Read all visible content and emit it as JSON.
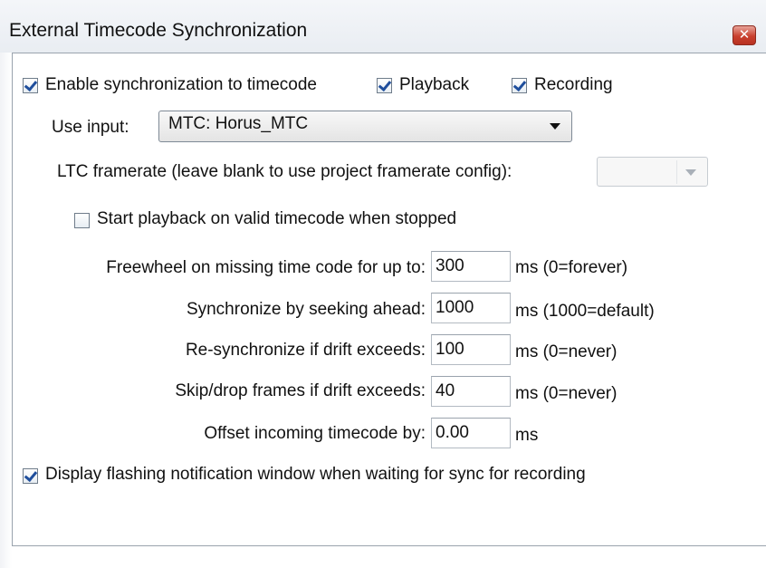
{
  "window": {
    "title": "External Timecode Synchronization",
    "close_glyph": "✕"
  },
  "sync": {
    "enable_label": "Enable synchronization to timecode",
    "enable_checked": true,
    "playback_label": "Playback",
    "playback_checked": true,
    "recording_label": "Recording",
    "recording_checked": true
  },
  "input": {
    "label": "Use input:",
    "value": "MTC: Horus_MTC"
  },
  "ltc": {
    "label": "LTC framerate (leave blank to use project framerate config):",
    "value": ""
  },
  "start_playback": {
    "label": "Start playback on valid timecode when stopped",
    "checked": false
  },
  "settings": {
    "freewheel": {
      "label": "Freewheel on missing time code for up to:",
      "value": "300",
      "unit": "ms (0=forever)"
    },
    "seek_ahead": {
      "label": "Synchronize by seeking ahead:",
      "value": "1000",
      "unit": "ms (1000=default)"
    },
    "resync": {
      "label": "Re-synchronize if drift exceeds:",
      "value": "100",
      "unit": "ms (0=never)"
    },
    "skip_drop": {
      "label": "Skip/drop frames if drift exceeds:",
      "value": "40",
      "unit": "ms (0=never)"
    },
    "offset": {
      "label": "Offset incoming timecode by:",
      "value": "0.00",
      "unit": "ms"
    }
  },
  "notification": {
    "label": "Display flashing notification window when waiting for sync for recording",
    "checked": true
  }
}
